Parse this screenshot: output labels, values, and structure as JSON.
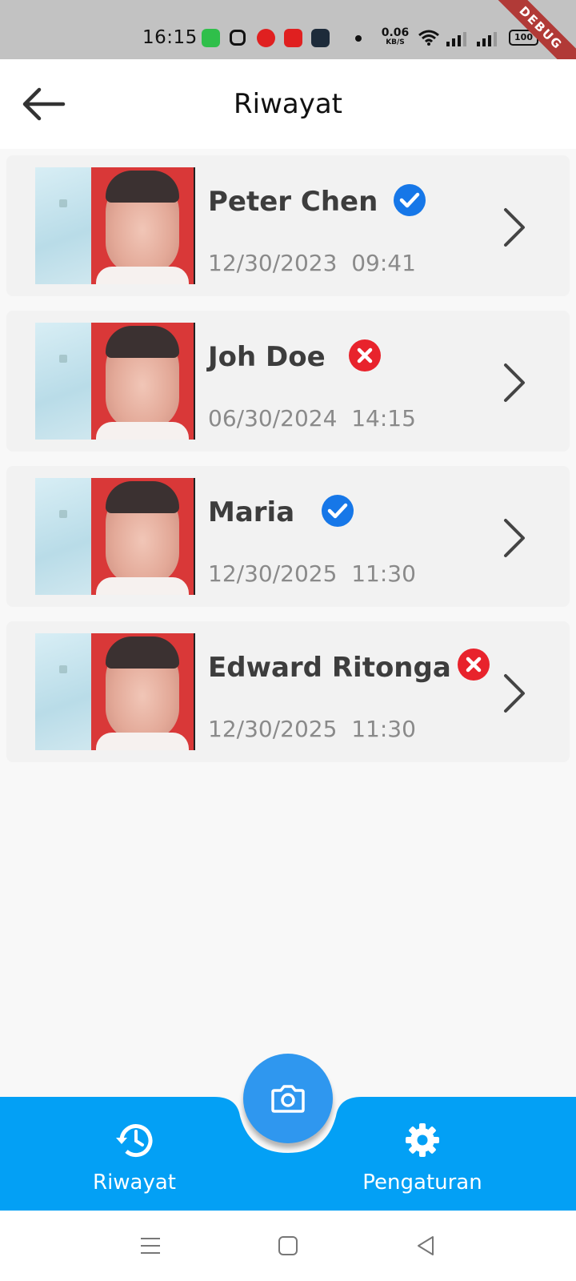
{
  "status_bar": {
    "time": "16:15",
    "net_speed_value": "0.06",
    "net_speed_unit": "KB/S",
    "battery": "100",
    "debug_banner": "DEBUG"
  },
  "header": {
    "title": "Riwayat",
    "back_icon": "arrow-left-icon"
  },
  "history": [
    {
      "name": "Peter Chen",
      "date": "12/30/2023",
      "time": "09:41",
      "status": "verified"
    },
    {
      "name": "Joh Doe",
      "date": "06/30/2024",
      "time": "14:15",
      "status": "rejected"
    },
    {
      "name": "Maria",
      "date": "12/30/2025",
      "time": "11:30",
      "status": "verified"
    },
    {
      "name": "Edward Ritonga",
      "date": "12/30/2025",
      "time": "11:30",
      "status": "rejected"
    }
  ],
  "bottom_nav": {
    "history_label": "Riwayat",
    "settings_label": "Pengaturan",
    "camera_icon": "camera-icon"
  },
  "colors": {
    "primary": "#03a0f5",
    "fab": "#2f97ef",
    "verified": "#1677e8",
    "rejected": "#e8232c"
  }
}
